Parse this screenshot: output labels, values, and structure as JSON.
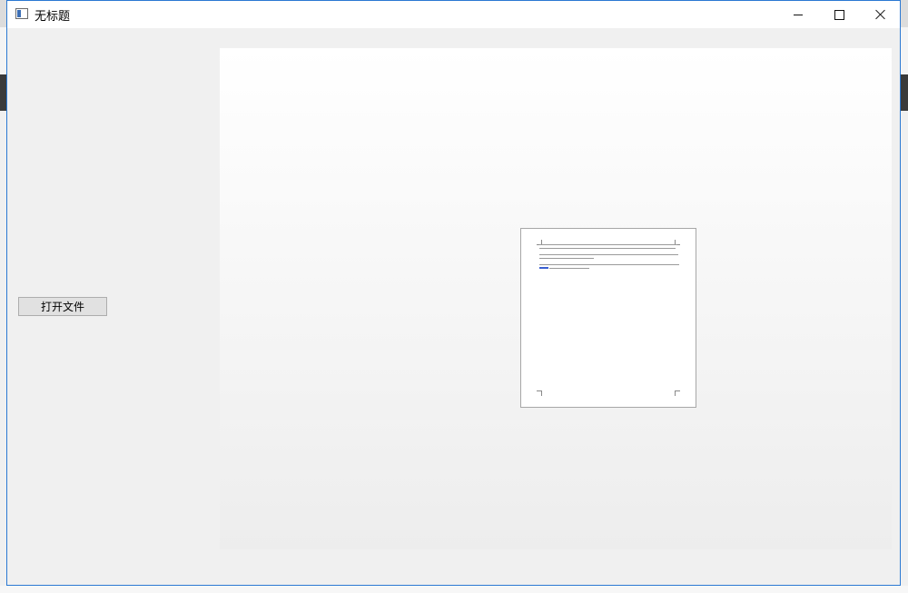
{
  "window": {
    "title": "无标题",
    "icon": "app-window-icon",
    "controls": [
      "minimize",
      "maximize",
      "close"
    ],
    "accent_color": "#2b79d3"
  },
  "sidebar": {
    "open_file_label": "打开文件"
  },
  "preview": {
    "document": "page-thumbnail"
  }
}
